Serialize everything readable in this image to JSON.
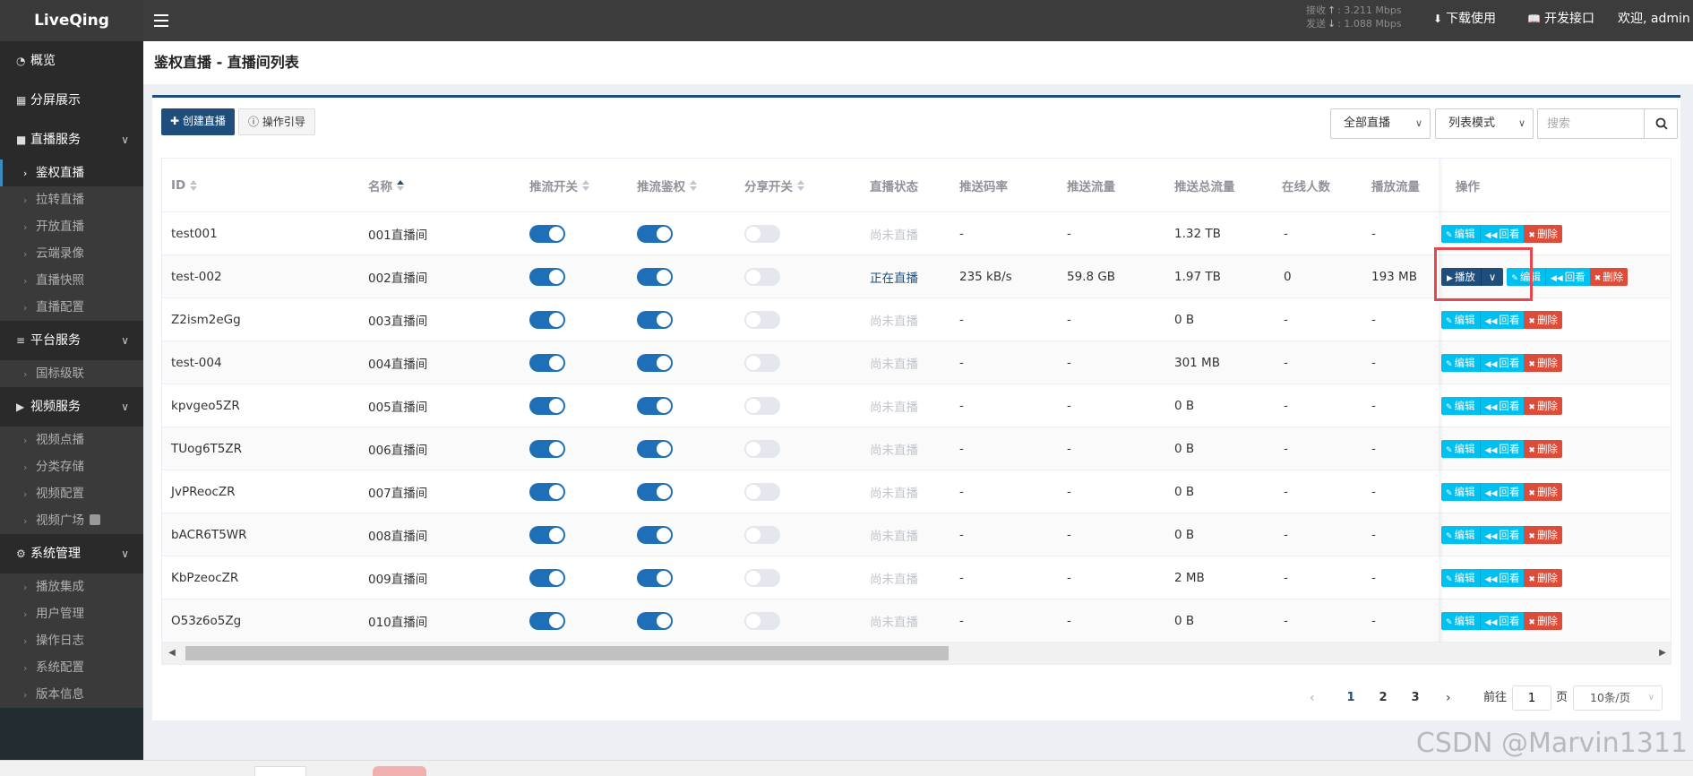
{
  "header": {
    "brand": "LiveQing",
    "net_recv_label": "接收",
    "net_recv_value": "3.211 Mbps",
    "net_send_label": "发送",
    "net_send_value": "1.088 Mbps",
    "download_label": "下载使用",
    "api_label": "开发接口",
    "welcome": "欢迎, admin"
  },
  "sidebar": {
    "overview": "概览",
    "split_screen": "分屏展示",
    "live_service": "直播服务",
    "live_items": [
      "鉴权直播",
      "拉转直播",
      "开放直播",
      "云端录像",
      "直播快照",
      "直播配置"
    ],
    "platform_service": "平台服务",
    "platform_items": [
      "国标级联"
    ],
    "video_service": "视频服务",
    "video_items": [
      "视频点播",
      "分类存储",
      "视频配置",
      "视频广场"
    ],
    "system_mgmt": "系统管理",
    "system_items": [
      "播放集成",
      "用户管理",
      "操作日志",
      "系统配置",
      "版本信息"
    ]
  },
  "page": {
    "title": "鉴权直播 - 直播间列表",
    "create_btn": "创建直播",
    "guide_btn": "操作引导",
    "filter_all": "全部直播",
    "view_mode": "列表模式",
    "search_placeholder": "搜索"
  },
  "table": {
    "columns": [
      "ID",
      "名称",
      "推流开关",
      "推流鉴权",
      "分享开关",
      "直播状态",
      "推送码率",
      "推送流量",
      "推送总流量",
      "在线人数",
      "播放流量",
      "操作"
    ],
    "rows": [
      {
        "id": "test001",
        "name": "001直播间",
        "push": true,
        "auth": true,
        "share": false,
        "status": "尚未直播",
        "live": false,
        "bitrate": "-",
        "traffic": "-",
        "total": "1.32 TB",
        "online": "-",
        "play": "-"
      },
      {
        "id": "test-002",
        "name": "002直播间",
        "push": true,
        "auth": true,
        "share": false,
        "status": "正在直播",
        "live": true,
        "bitrate": "235 kB/s",
        "traffic": "59.8 GB",
        "total": "1.97 TB",
        "online": "0",
        "play": "193 MB"
      },
      {
        "id": "Z2ism2eGg",
        "name": "003直播间",
        "push": true,
        "auth": true,
        "share": false,
        "status": "尚未直播",
        "live": false,
        "bitrate": "-",
        "traffic": "-",
        "total": "0 B",
        "online": "-",
        "play": "-"
      },
      {
        "id": "test-004",
        "name": "004直播间",
        "push": true,
        "auth": true,
        "share": false,
        "status": "尚未直播",
        "live": false,
        "bitrate": "-",
        "traffic": "-",
        "total": "301 MB",
        "online": "-",
        "play": "-"
      },
      {
        "id": "kpvgeo5ZR",
        "name": "005直播间",
        "push": true,
        "auth": true,
        "share": false,
        "status": "尚未直播",
        "live": false,
        "bitrate": "-",
        "traffic": "-",
        "total": "0 B",
        "online": "-",
        "play": "-"
      },
      {
        "id": "TUog6T5ZR",
        "name": "006直播间",
        "push": true,
        "auth": true,
        "share": false,
        "status": "尚未直播",
        "live": false,
        "bitrate": "-",
        "traffic": "-",
        "total": "0 B",
        "online": "-",
        "play": "-"
      },
      {
        "id": "JvPReocZR",
        "name": "007直播间",
        "push": true,
        "auth": true,
        "share": false,
        "status": "尚未直播",
        "live": false,
        "bitrate": "-",
        "traffic": "-",
        "total": "0 B",
        "online": "-",
        "play": "-"
      },
      {
        "id": "bACR6T5WR",
        "name": "008直播间",
        "push": true,
        "auth": true,
        "share": false,
        "status": "尚未直播",
        "live": false,
        "bitrate": "-",
        "traffic": "-",
        "total": "0 B",
        "online": "-",
        "play": "-"
      },
      {
        "id": "KbPzeocZR",
        "name": "009直播间",
        "push": true,
        "auth": true,
        "share": false,
        "status": "尚未直播",
        "live": false,
        "bitrate": "-",
        "traffic": "-",
        "total": "2 MB",
        "online": "-",
        "play": "-"
      },
      {
        "id": "O53z6o5Zg",
        "name": "010直播间",
        "push": true,
        "auth": true,
        "share": false,
        "status": "尚未直播",
        "live": false,
        "bitrate": "-",
        "traffic": "-",
        "total": "0 B",
        "online": "-",
        "play": "-"
      }
    ],
    "op_play": "播放",
    "op_edit": "编辑",
    "op_replay": "回看",
    "op_delete": "删除"
  },
  "pagination": {
    "pages": [
      "1",
      "2",
      "3"
    ],
    "current": "1",
    "goto_label": "前往",
    "page_unit": "页",
    "goto_value": "1",
    "page_size": "10条/页"
  },
  "watermark": "CSDN @Marvin1311",
  "colors": {
    "primary": "#1f4e7d",
    "info": "#00c0ef",
    "danger": "#dd4b39",
    "highlight": "#e8474e"
  }
}
